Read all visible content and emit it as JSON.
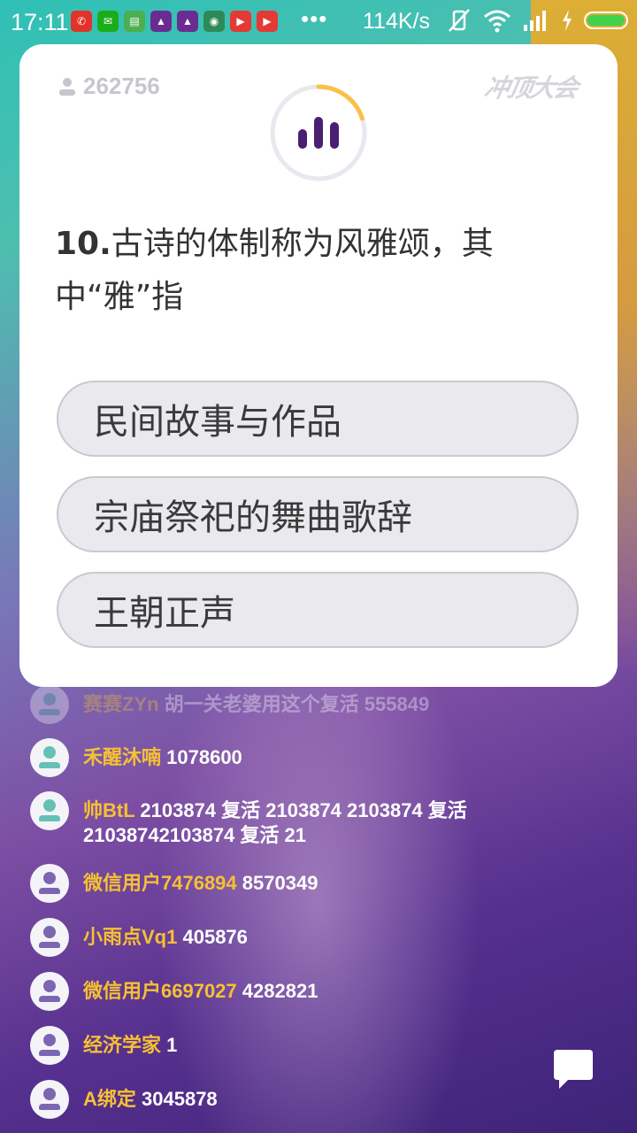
{
  "status_bar": {
    "time": "17:11",
    "app_icons": [
      {
        "name": "weibo-icon",
        "color": "#e2322a",
        "glyph": "✆"
      },
      {
        "name": "wechat-icon",
        "color": "#1aad19",
        "glyph": "✉"
      },
      {
        "name": "notes-icon",
        "color": "#4caf50",
        "glyph": "▤"
      },
      {
        "name": "chongding-icon",
        "color": "#6a2c91",
        "glyph": "▲"
      },
      {
        "name": "chongding-icon-2",
        "color": "#6a2c91",
        "glyph": "▲"
      },
      {
        "name": "android-icon",
        "color": "#3ddc84",
        "glyph": "◉"
      },
      {
        "name": "video-icon",
        "color": "#e53935",
        "glyph": "▶"
      },
      {
        "name": "video-icon-2",
        "color": "#e53935",
        "glyph": "▶"
      }
    ],
    "more": "•••",
    "net_speed": "114K/s"
  },
  "card": {
    "viewer_count": "262756",
    "brand_logo": "冲顶大会",
    "timer_fraction": 0.2,
    "question_number": "10.",
    "question_text": "古诗的体制称为风雅颂，其中“雅”指",
    "options": [
      {
        "label": "民间故事与作品"
      },
      {
        "label": "宗庙祭祀的舞曲歌辞"
      },
      {
        "label": "王朝正声"
      }
    ]
  },
  "comments": [
    {
      "name": "赛赛ZYn",
      "message": "胡一关老婆用这个复活 555849"
    },
    {
      "name": "禾醒沐喃",
      "message": "1078600"
    },
    {
      "name": "帅BtL",
      "message": "2103874 复活 2103874 2103874 复活 21038742103874 复活 21"
    },
    {
      "name": "微信用户7476894",
      "message": "8570349"
    },
    {
      "name": "小雨点Vq1",
      "message": "405876"
    },
    {
      "name": "微信用户6697027",
      "message": "4282821"
    },
    {
      "name": "经济学家",
      "message": "1"
    },
    {
      "name": "A绑定",
      "message": "3045878"
    }
  ],
  "colors": {
    "accent_yellow": "#f6c034",
    "timer_arc": "#f7c14a",
    "timer_track": "#e8e8ee",
    "bars": "#4a1f72"
  }
}
